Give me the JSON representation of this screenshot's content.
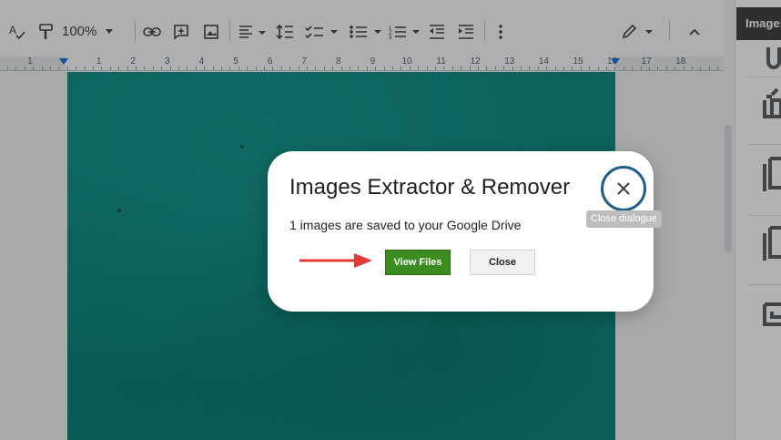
{
  "toolbar": {
    "zoom_value": "100%",
    "icons": [
      "spellcheck-icon",
      "paint-format-icon",
      "link-icon",
      "add-comment-icon",
      "insert-image-icon",
      "align-left-icon",
      "line-spacing-icon",
      "checklist-icon",
      "bulleted-list-icon",
      "numbered-list-icon",
      "decrease-indent-icon",
      "increase-indent-icon",
      "more-options-icon",
      "editing-mode-pencil-icon",
      "collapse-menus-icon"
    ]
  },
  "ruler": {
    "left_numbers": [
      "1"
    ],
    "numbers": [
      "1",
      "2",
      "3",
      "4",
      "5",
      "6",
      "7",
      "8",
      "9",
      "10",
      "11",
      "12",
      "13",
      "14",
      "15",
      "16",
      "17",
      "18"
    ]
  },
  "sidebar": {
    "tab_label": "Images"
  },
  "dialog": {
    "title": "Images Extractor & Remover",
    "message": "1 images are saved to your Google Drive",
    "view_files_label": "View Files",
    "close_label": "Close",
    "close_tooltip": "Close dialogue"
  },
  "colors": {
    "accent_green": "#3b8d1f",
    "annotation_arrow": "#e53935",
    "close_ring": "#1d5f8a",
    "image_teal": "#138f85"
  }
}
